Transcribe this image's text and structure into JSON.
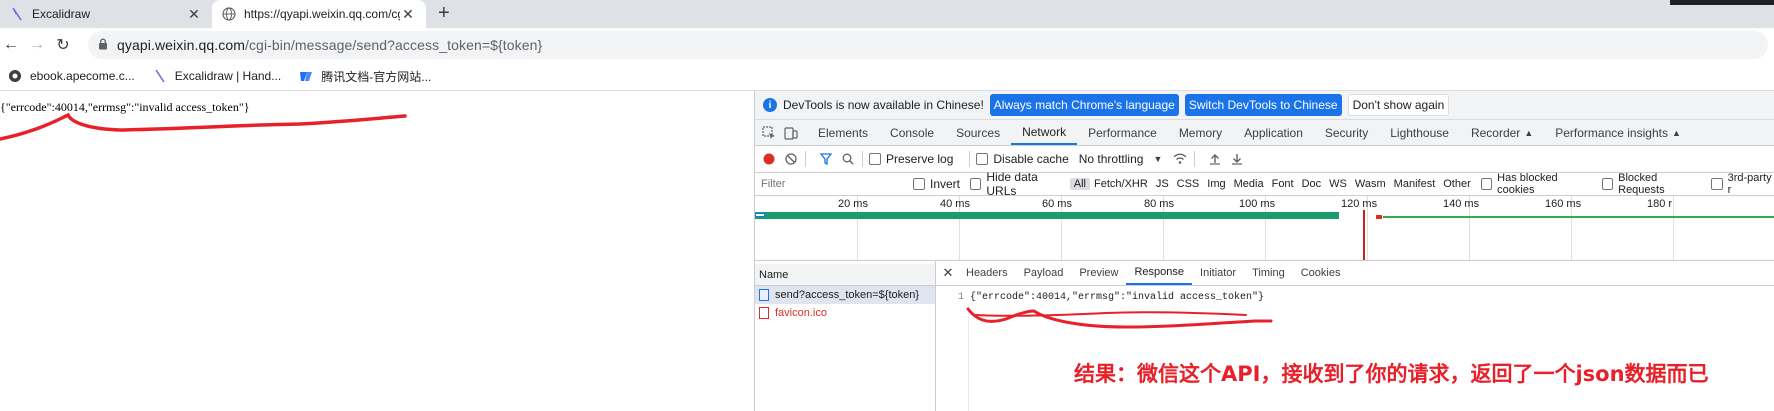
{
  "browser": {
    "tabs": [
      {
        "title": "Excalidraw",
        "icon": "excalidraw-icon",
        "active": false
      },
      {
        "title": "https://qyapi.weixin.qq.com/cg",
        "icon": "globe-icon",
        "active": true
      }
    ],
    "address": {
      "host": "qyapi.weixin.qq.com",
      "path": "/cgi-bin/message/send?access_token=${token}"
    },
    "bookmarks": [
      {
        "label": "ebook.apecome.c...",
        "icon": "bookmark-site-icon"
      },
      {
        "label": "Excalidraw | Hand...",
        "icon": "excalidraw-icon"
      },
      {
        "label": "腾讯文档-官方网站...",
        "icon": "tencent-docs-icon"
      }
    ]
  },
  "page": {
    "body_text": "{\"errcode\":40014,\"errmsg\":\"invalid access_token\"}"
  },
  "devtools": {
    "infobar": {
      "message": "DevTools is now available in Chinese!",
      "btn_match": "Always match Chrome's language",
      "btn_switch": "Switch DevTools to Chinese",
      "btn_dismiss": "Don't show again"
    },
    "tabs": [
      "Elements",
      "Console",
      "Sources",
      "Network",
      "Performance",
      "Memory",
      "Application",
      "Security",
      "Lighthouse",
      "Recorder",
      "Performance insights"
    ],
    "selected_tab": "Network",
    "network_toolbar": {
      "preserve_log": "Preserve log",
      "disable_cache": "Disable cache",
      "throttling": "No throttling"
    },
    "filter": {
      "placeholder": "Filter",
      "invert": "Invert",
      "hide_data_urls": "Hide data URLs",
      "types": [
        "All",
        "Fetch/XHR",
        "JS",
        "CSS",
        "Img",
        "Media",
        "Font",
        "Doc",
        "WS",
        "Wasm",
        "Manifest",
        "Other"
      ],
      "has_blocked_cookies": "Has blocked cookies",
      "blocked_requests": "Blocked Requests",
      "third_party": "3rd-party r"
    },
    "timeline_ticks": [
      "20 ms",
      "40 ms",
      "60 ms",
      "80 ms",
      "100 ms",
      "120 ms",
      "140 ms",
      "160 ms",
      "180 r"
    ],
    "requests_header": "Name",
    "requests": [
      {
        "name": "send?access_token=${token}",
        "status": "ok"
      },
      {
        "name": "favicon.ico",
        "status": "error"
      }
    ],
    "detail_tabs": [
      "Headers",
      "Payload",
      "Preview",
      "Response",
      "Initiator",
      "Timing",
      "Cookies"
    ],
    "selected_detail_tab": "Response",
    "response_line_number": "1",
    "response_body": "{\"errcode\":40014,\"errmsg\":\"invalid access_token\"}"
  },
  "annotation": "结果：微信这个API，接收到了你的请求，返回了一个json数据而已",
  "colors": {
    "annotation_red": "#e8202a",
    "accent_blue": "#1a73e8",
    "timeline_bar": "#1a9c6c"
  }
}
